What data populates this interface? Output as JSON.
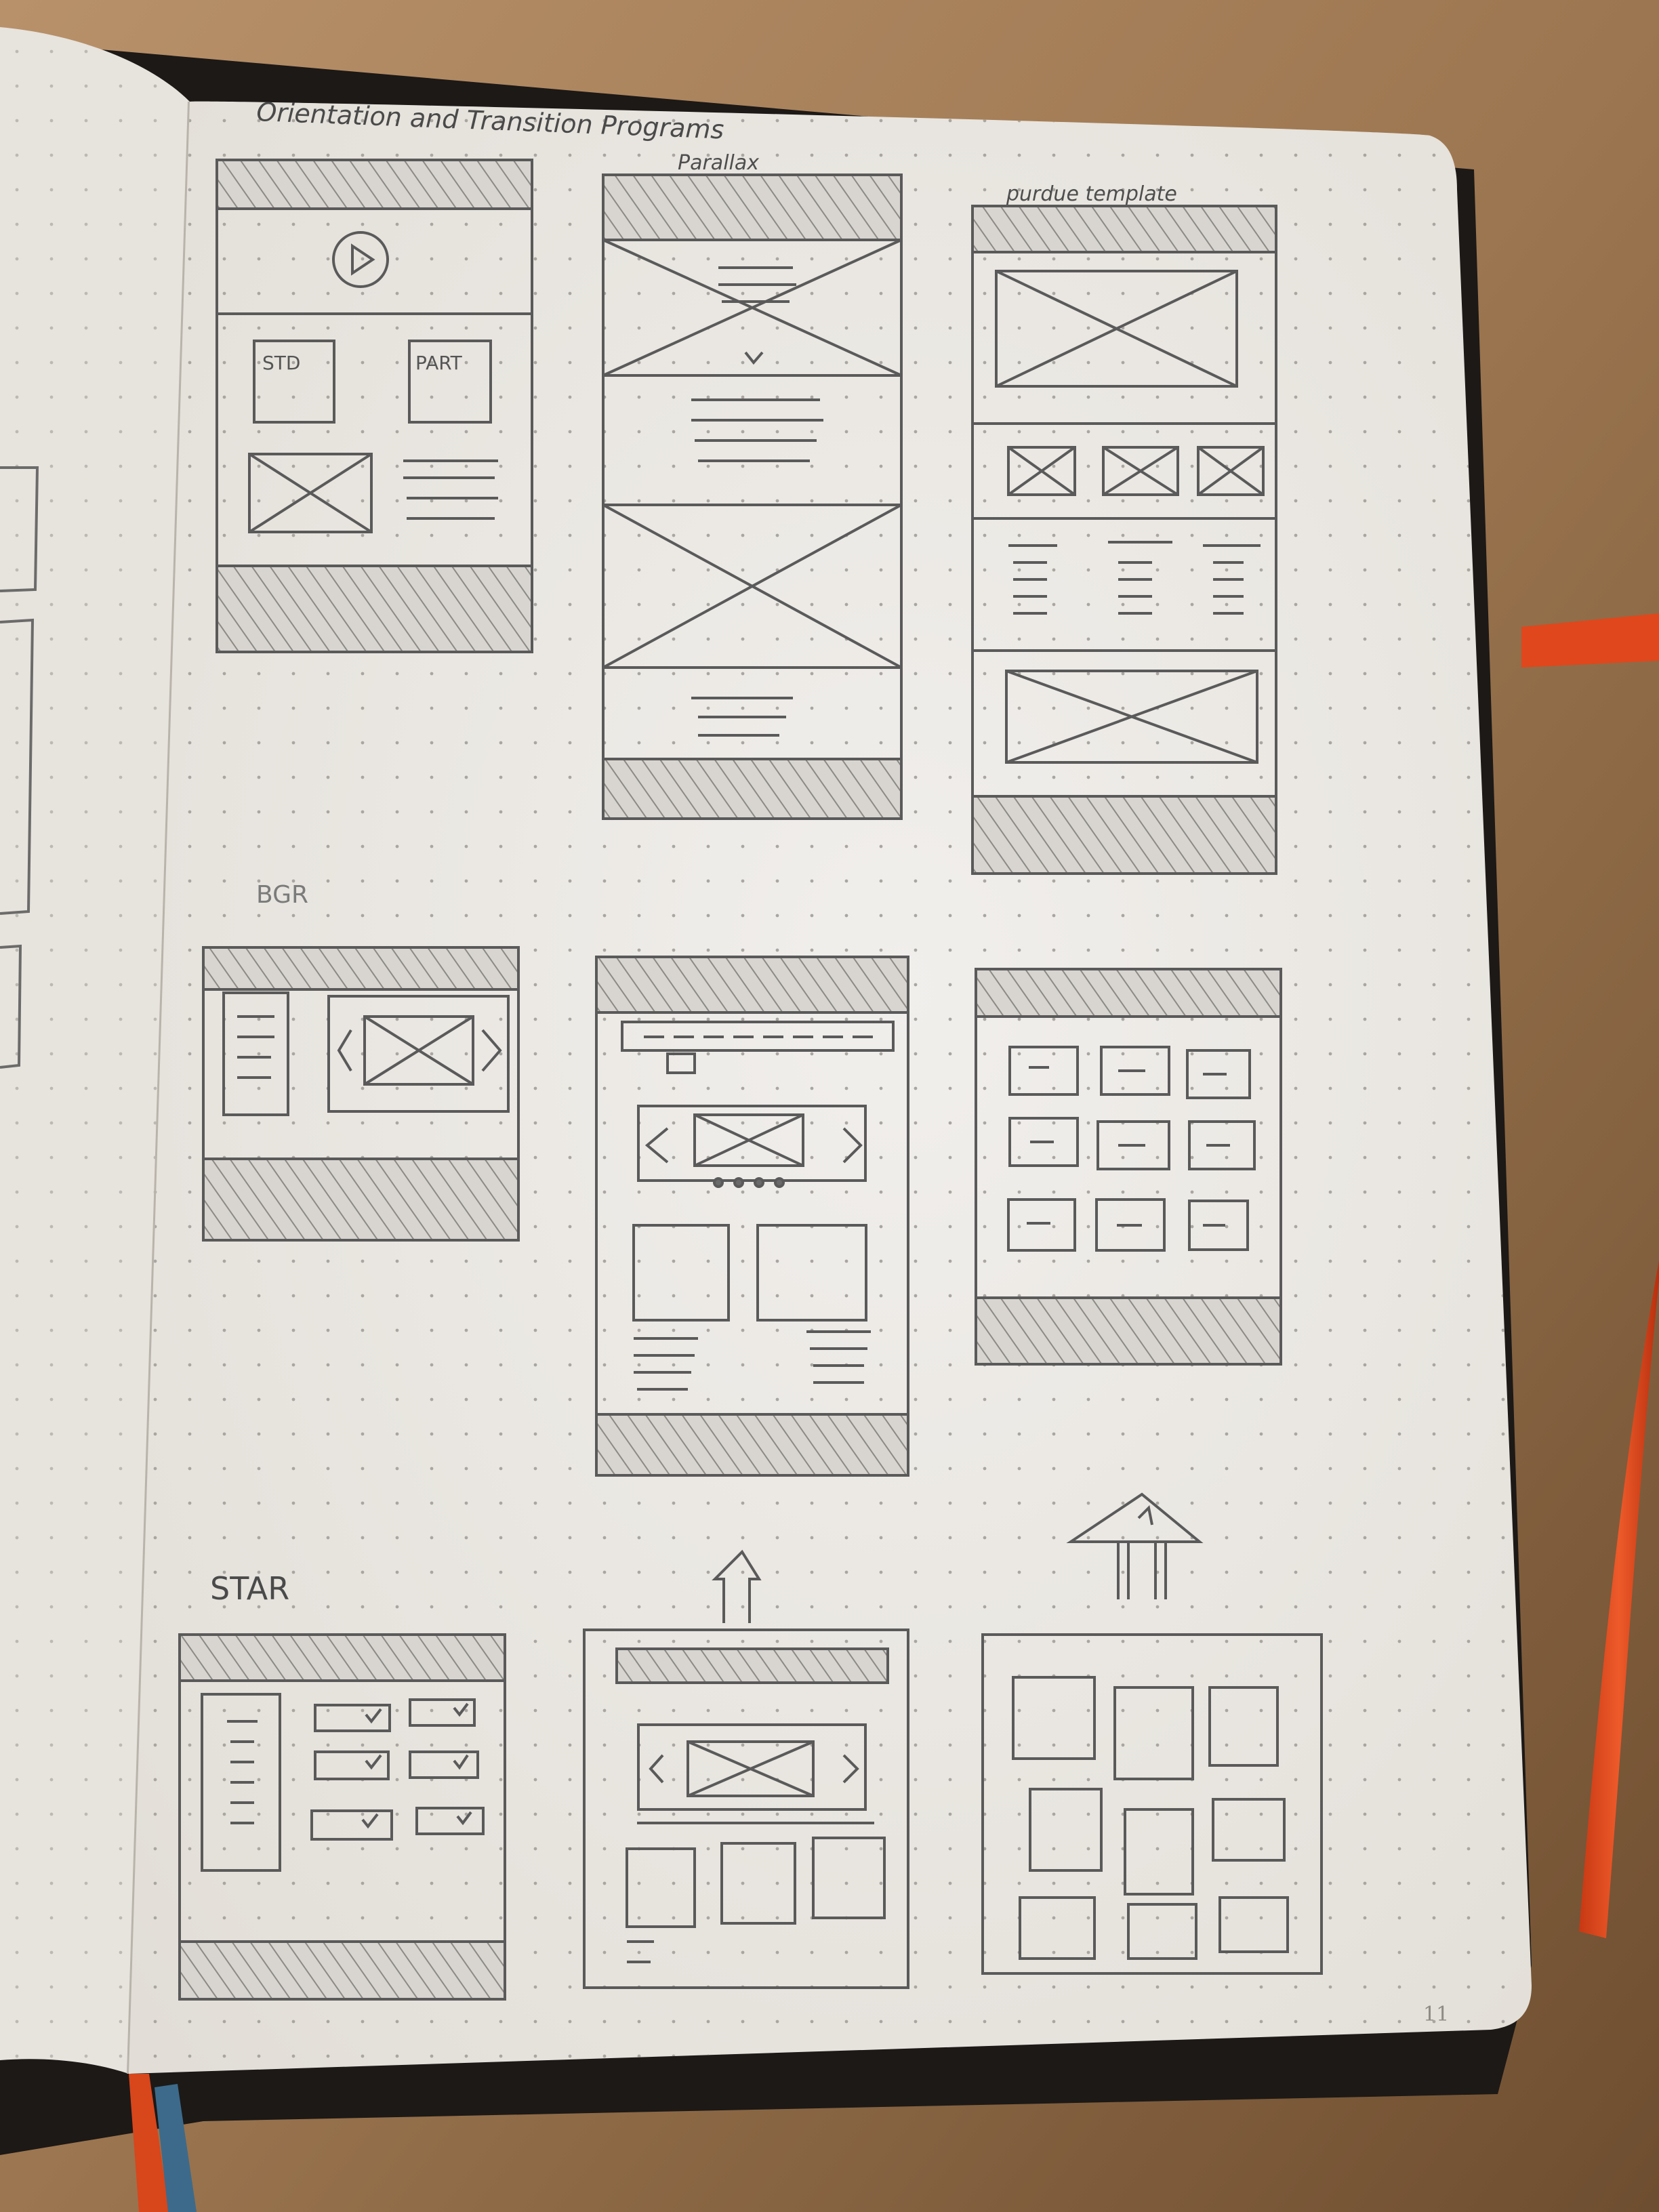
{
  "page": {
    "heading": "Orientation and Transition Programs",
    "page_number": "11"
  },
  "sketches": {
    "orientation": {
      "buttons": [
        "STD",
        "PART"
      ]
    },
    "parallax": {
      "label": "Parallax"
    },
    "purdue": {
      "label": "purdue template"
    },
    "bgr": {
      "label": "BGR"
    },
    "star": {
      "label": "STAR"
    }
  },
  "colors": {
    "desk": "#9a7550",
    "paper": "#efedea",
    "dot_grid": "#a9a6a1",
    "pencil": "#5a5a5a",
    "ribbon": "#e0471c",
    "cover": "#1c1917"
  }
}
